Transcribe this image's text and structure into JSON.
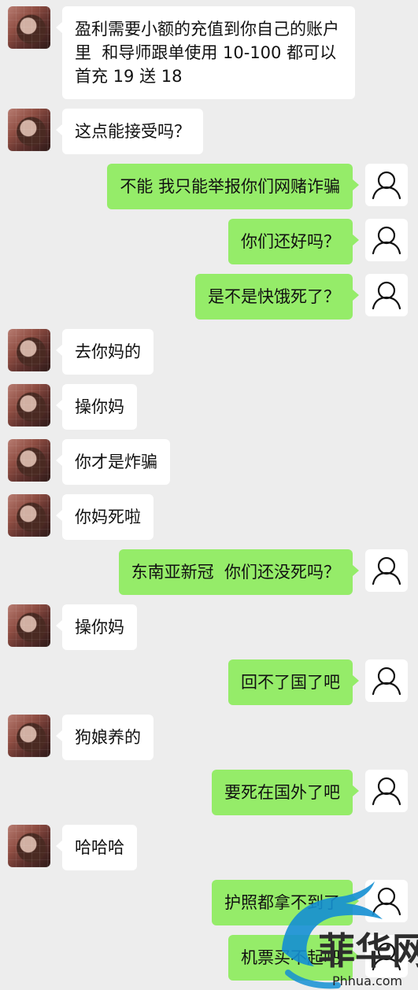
{
  "messages": [
    {
      "side": "left",
      "text": "盈利需要小额的充值到你自己的账户里  和导师跟单使用 10-100 都可以  首充 19 送 18"
    },
    {
      "side": "left",
      "text": "这点能接受吗？"
    },
    {
      "side": "right",
      "text": "不能 我只能举报你们网赌诈骗"
    },
    {
      "side": "right",
      "text": "你们还好吗？"
    },
    {
      "side": "right",
      "text": "是不是快饿死了？"
    },
    {
      "side": "left",
      "text": "去你妈的"
    },
    {
      "side": "left",
      "text": "操你妈"
    },
    {
      "side": "left",
      "text": "你才是炸骗"
    },
    {
      "side": "left",
      "text": "你妈死啦"
    },
    {
      "side": "right",
      "text": "东南亚新冠  你们还没死吗？"
    },
    {
      "side": "left",
      "text": "操你妈"
    },
    {
      "side": "right",
      "text": "回不了国了吧"
    },
    {
      "side": "left",
      "text": "狗娘养的"
    },
    {
      "side": "right",
      "text": "要死在国外了吧"
    },
    {
      "side": "left",
      "text": "哈哈哈"
    },
    {
      "side": "right",
      "text": "护照都拿不到了"
    },
    {
      "side": "right",
      "text": "机票买不起吧"
    }
  ],
  "watermark": {
    "logo_text": "菲华网",
    "url": "Phhua.com"
  },
  "colors": {
    "background": "#ededed",
    "incoming_bubble": "#ffffff",
    "outgoing_bubble": "#95ec69"
  },
  "icons": {
    "incoming_avatar": "profile-photo",
    "outgoing_avatar": "default-user-icon"
  }
}
